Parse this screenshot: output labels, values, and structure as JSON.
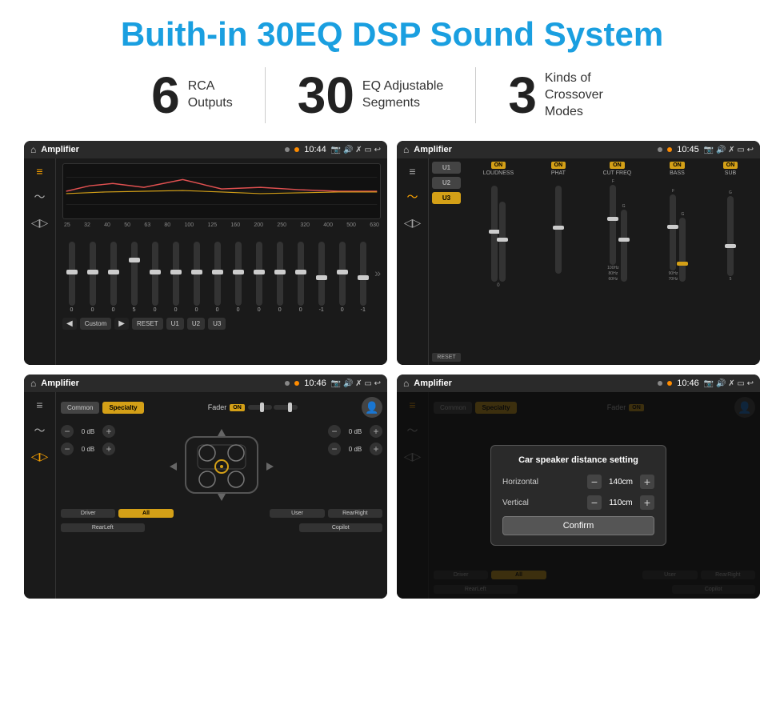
{
  "title": "Buith-in 30EQ DSP Sound System",
  "stats": [
    {
      "number": "6",
      "label": "RCA\nOutputs"
    },
    {
      "number": "30",
      "label": "EQ Adjustable\nSegments"
    },
    {
      "number": "3",
      "label": "Kinds of\nCrossover Modes"
    }
  ],
  "screens": [
    {
      "id": "eq-screen",
      "status_bar": {
        "title": "Amplifier",
        "time": "10:44"
      },
      "type": "equalizer",
      "freq_labels": [
        "25",
        "32",
        "40",
        "50",
        "63",
        "80",
        "100",
        "125",
        "160",
        "200",
        "250",
        "320",
        "400",
        "500",
        "630"
      ],
      "slider_values": [
        "0",
        "0",
        "0",
        "5",
        "0",
        "0",
        "0",
        "0",
        "0",
        "0",
        "0",
        "0",
        "-1",
        "0",
        "-1"
      ],
      "buttons": [
        "Custom",
        "RESET",
        "U1",
        "U2",
        "U3"
      ]
    },
    {
      "id": "crossover-screen",
      "status_bar": {
        "title": "Amplifier",
        "time": "10:45"
      },
      "type": "crossover",
      "presets": [
        "U1",
        "U2",
        "U3"
      ],
      "channels": [
        {
          "label": "LOUDNESS",
          "on": true
        },
        {
          "label": "PHAT",
          "on": true
        },
        {
          "label": "CUT FREQ",
          "on": true
        },
        {
          "label": "BASS",
          "on": true
        },
        {
          "label": "SUB",
          "on": true
        }
      ]
    },
    {
      "id": "fader-screen",
      "status_bar": {
        "title": "Amplifier",
        "time": "10:46"
      },
      "type": "fader",
      "tabs": [
        "Common",
        "Specialty"
      ],
      "active_tab": "Specialty",
      "fader_label": "Fader",
      "volumes": [
        "0 dB",
        "0 dB",
        "0 dB",
        "0 dB"
      ],
      "bottom_btns": [
        "Driver",
        "All",
        "User",
        "RearLeft",
        "RearRight",
        "Copilot"
      ]
    },
    {
      "id": "dialog-screen",
      "status_bar": {
        "title": "Amplifier",
        "time": "10:46"
      },
      "type": "dialog",
      "tabs": [
        "Common",
        "Specialty"
      ],
      "dialog": {
        "title": "Car speaker distance setting",
        "fields": [
          {
            "label": "Horizontal",
            "value": "140cm"
          },
          {
            "label": "Vertical",
            "value": "110cm"
          }
        ],
        "confirm_label": "Confirm"
      },
      "bottom_btns": [
        "Driver",
        "All",
        "User",
        "RearLeft",
        "RearRight",
        "Copilot"
      ]
    }
  ]
}
